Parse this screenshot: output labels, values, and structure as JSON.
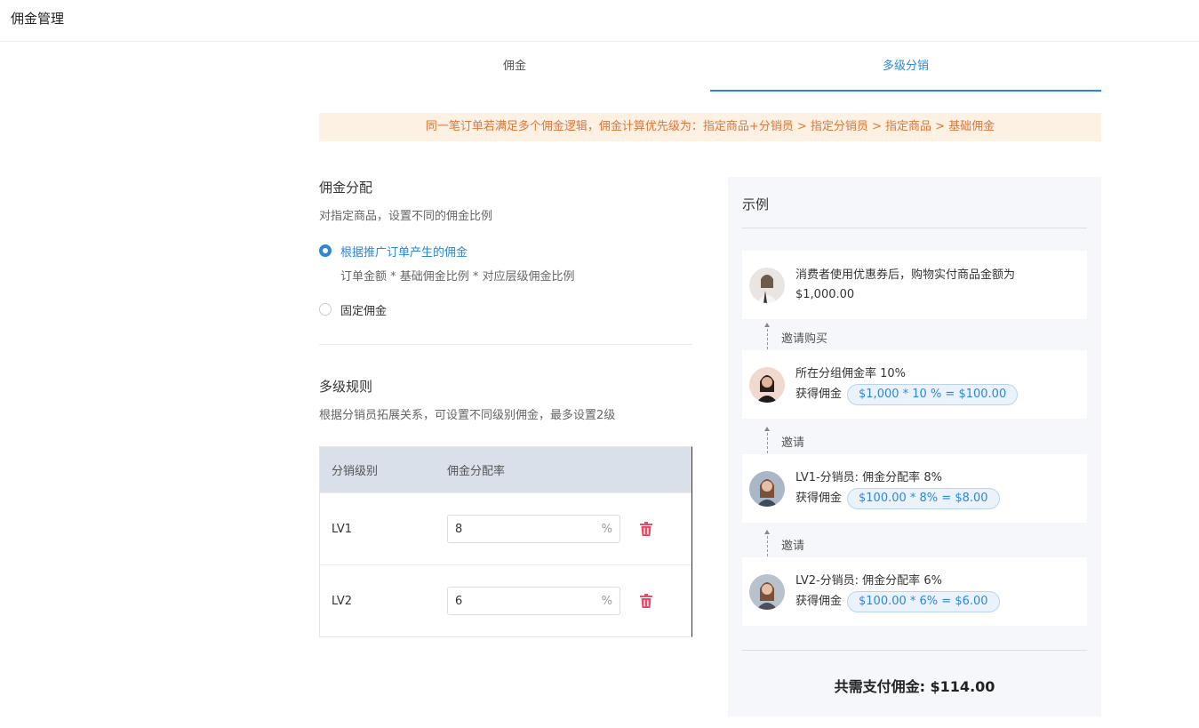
{
  "header": {
    "title": "佣金管理"
  },
  "tabs": [
    {
      "label": "佣金",
      "active": false
    },
    {
      "label": "多级分销",
      "active": true
    }
  ],
  "notice": "同一笔订单若满足多个佣金逻辑，佣金计算优先级为：指定商品+分销员 > 指定分销员 > 指定商品 > 基础佣金",
  "allocation": {
    "title": "佣金分配",
    "desc": "对指定商品，设置不同的佣金比例",
    "options": [
      {
        "label": "根据推广订单产生的佣金",
        "sub": "订单金额 * 基础佣金比例 * 对应层级佣金比例",
        "checked": true
      },
      {
        "label": "固定佣金",
        "checked": false
      }
    ]
  },
  "rules": {
    "title": "多级规则",
    "desc": "根据分销员拓展关系，可设置不同级别佣金，最多设置2级",
    "columns": [
      "分销级别",
      "佣金分配率"
    ],
    "rows": [
      {
        "level": "LV1",
        "rate": "8",
        "unit": "%"
      },
      {
        "level": "LV2",
        "rate": "6",
        "unit": "%"
      }
    ]
  },
  "example": {
    "title": "示例",
    "cards": [
      {
        "line1": "消费者使用优惠券后，购物实付商品金额为",
        "line2": "$1,000.00"
      },
      {
        "line1": "所在分组佣金率 10%",
        "earn_label": "获得佣金",
        "formula": "$1,000 * 10 % = $100.00"
      },
      {
        "line1": "LV1-分销员: 佣金分配率 8%",
        "earn_label": "获得佣金",
        "formula": "$100.00 * 8% = $8.00"
      },
      {
        "line1": "LV2-分销员: 佣金分配率 6%",
        "earn_label": "获得佣金",
        "formula": "$100.00 * 6% = $6.00"
      }
    ],
    "connectors": [
      "邀请购买",
      "邀请",
      "邀请"
    ],
    "total": "共需支付佣金: $114.00"
  },
  "colors": {
    "accent": "#2f86d6",
    "notice_bg": "#fdf1e4",
    "notice_text": "#e1763a",
    "delete": "#e0506a"
  }
}
